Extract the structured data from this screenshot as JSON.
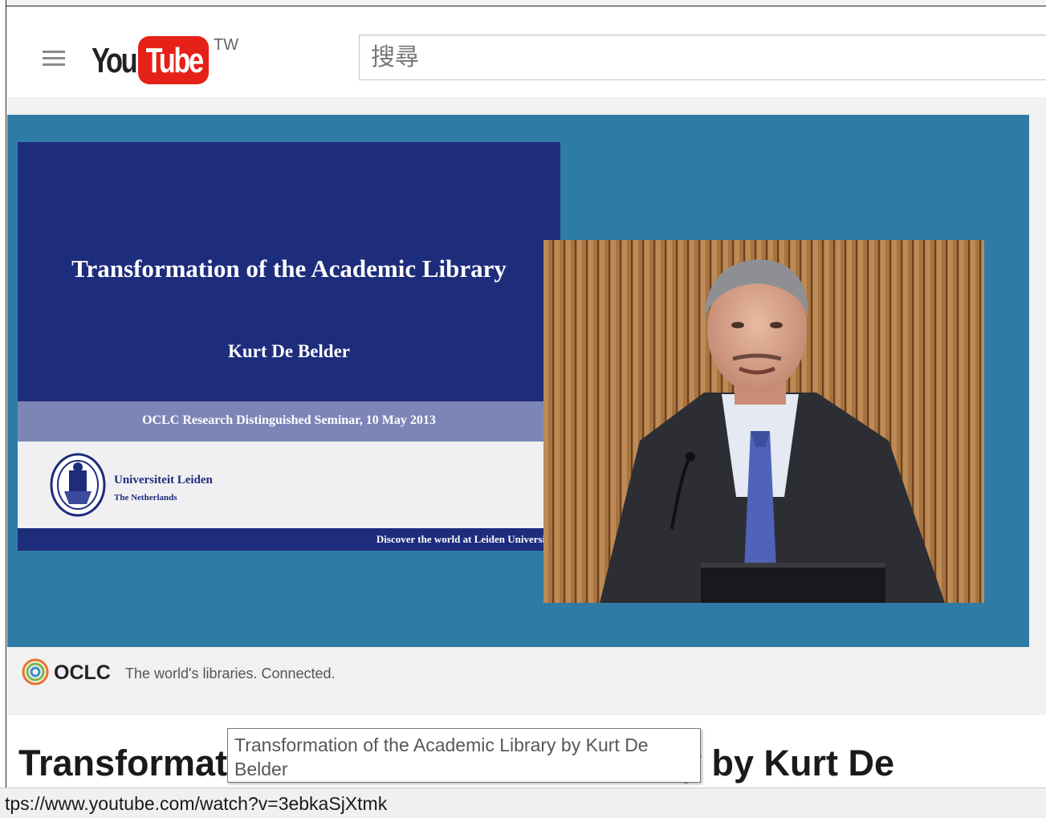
{
  "masthead": {
    "logo_you": "You",
    "logo_tube": "Tube",
    "logo_region": "TW",
    "search_placeholder": "搜尋"
  },
  "slide": {
    "title": "Transformation of the Academic Library",
    "author": "Kurt De Belder",
    "seminar": "OCLC Research Distinguished Seminar, 10 May 2013",
    "university": "Universiteit Leiden",
    "country": "The Netherlands",
    "tagline": "Discover the world at Leiden University"
  },
  "oclc_bar": {
    "brand": "OCLC",
    "tagline": "The world's libraries. Connected."
  },
  "video": {
    "title": "Transformation of the Academic Library by Kurt De Belder"
  },
  "tooltip": {
    "text": "Transformation of the Academic Library by Kurt De Belder"
  },
  "status_bar": {
    "url": "tps://www.youtube.com/watch?v=3ebkaSjXtmk"
  },
  "colors": {
    "player_blue": "#2e7ca6",
    "slide_navy": "#1e2c7c",
    "youtube_red": "#e62117"
  }
}
